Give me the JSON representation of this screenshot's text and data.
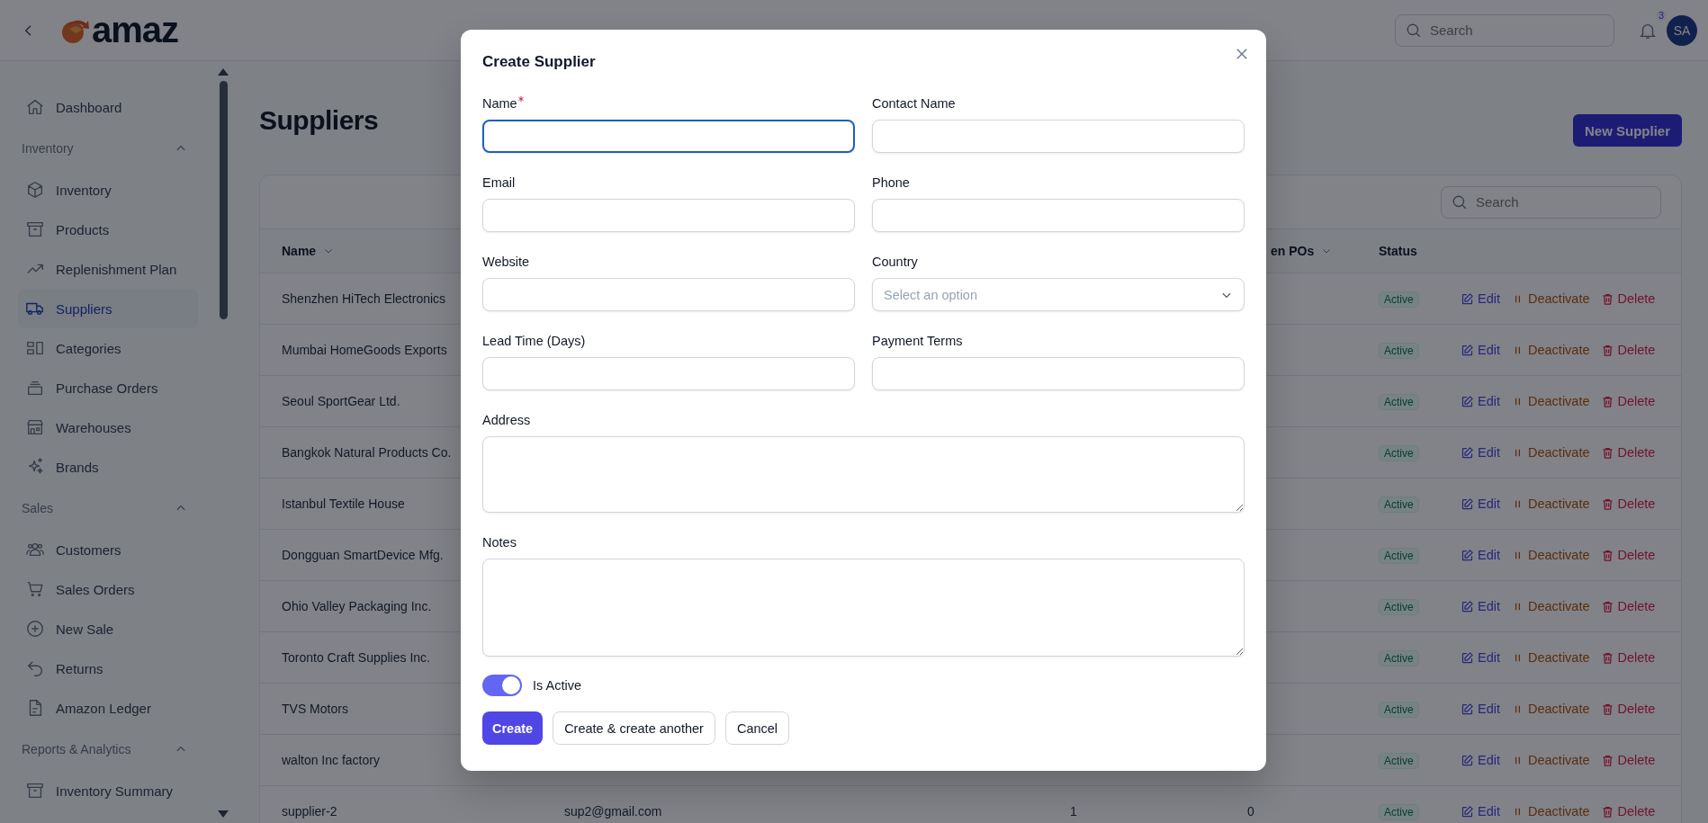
{
  "topbar": {
    "logo_text": "amaz",
    "search": {
      "placeholder": "Search"
    },
    "notifications": {
      "badge": "3"
    },
    "avatar": "SA"
  },
  "sidebar": {
    "items": [
      {
        "kind": "link",
        "label": "Dashboard",
        "selected": false
      },
      {
        "kind": "section",
        "label": "Inventory",
        "expanded": true
      },
      {
        "kind": "link",
        "label": "Inventory",
        "selected": false
      },
      {
        "kind": "link",
        "label": "Products",
        "selected": false
      },
      {
        "kind": "link",
        "label": "Replenishment Plan",
        "selected": false
      },
      {
        "kind": "link",
        "label": "Suppliers",
        "selected": true
      },
      {
        "kind": "link",
        "label": "Categories",
        "selected": false
      },
      {
        "kind": "link",
        "label": "Purchase Orders",
        "selected": false
      },
      {
        "kind": "link",
        "label": "Warehouses",
        "selected": false
      },
      {
        "kind": "link",
        "label": "Brands",
        "selected": false
      },
      {
        "kind": "section",
        "label": "Sales",
        "expanded": true
      },
      {
        "kind": "link",
        "label": "Customers",
        "selected": false
      },
      {
        "kind": "link",
        "label": "Sales Orders",
        "selected": false
      },
      {
        "kind": "link",
        "label": "New Sale",
        "selected": false
      },
      {
        "kind": "link",
        "label": "Returns",
        "selected": false
      },
      {
        "kind": "link",
        "label": "Amazon Ledger",
        "selected": false
      },
      {
        "kind": "section",
        "label": "Reports & Analytics",
        "expanded": true
      },
      {
        "kind": "link",
        "label": "Inventory Summary",
        "selected": false
      }
    ]
  },
  "page": {
    "title": "Suppliers",
    "new_button": "New Supplier",
    "table": {
      "search": {
        "placeholder": "Search"
      },
      "columns": [
        {
          "label": "Name",
          "sortable": true
        },
        {
          "label": "en POs",
          "sortable": true
        },
        {
          "label": "Status",
          "sortable": false
        }
      ],
      "rows": [
        {
          "name": "Shenzhen HiTech Electronics",
          "status": "Active",
          "actions": [
            {
              "kind": "edit",
              "label": "Edit"
            },
            {
              "kind": "deactivate",
              "label": "Deactivate"
            },
            {
              "kind": "delete",
              "label": "Delete"
            }
          ]
        },
        {
          "name": "Mumbai HomeGoods Exports",
          "status": "Active",
          "actions": [
            {
              "kind": "edit",
              "label": "Edit"
            },
            {
              "kind": "deactivate",
              "label": "Deactivate"
            },
            {
              "kind": "delete",
              "label": "Delete"
            }
          ]
        },
        {
          "name": "Seoul SportGear Ltd.",
          "status": "Active",
          "actions": [
            {
              "kind": "edit",
              "label": "Edit"
            },
            {
              "kind": "deactivate",
              "label": "Deactivate"
            },
            {
              "kind": "delete",
              "label": "Delete"
            }
          ]
        },
        {
          "name": "Bangkok Natural Products Co.",
          "status": "Active",
          "actions": [
            {
              "kind": "edit",
              "label": "Edit"
            },
            {
              "kind": "deactivate",
              "label": "Deactivate"
            },
            {
              "kind": "delete",
              "label": "Delete"
            }
          ]
        },
        {
          "name": "Istanbul Textile House",
          "status": "Active",
          "actions": [
            {
              "kind": "edit",
              "label": "Edit"
            },
            {
              "kind": "deactivate",
              "label": "Deactivate"
            },
            {
              "kind": "delete",
              "label": "Delete"
            }
          ]
        },
        {
          "name": "Dongguan SmartDevice Mfg.",
          "status": "Active",
          "actions": [
            {
              "kind": "edit",
              "label": "Edit"
            },
            {
              "kind": "deactivate",
              "label": "Deactivate"
            },
            {
              "kind": "delete",
              "label": "Delete"
            }
          ]
        },
        {
          "name": "Ohio Valley Packaging Inc.",
          "status": "Active",
          "actions": [
            {
              "kind": "edit",
              "label": "Edit"
            },
            {
              "kind": "deactivate",
              "label": "Deactivate"
            },
            {
              "kind": "delete",
              "label": "Delete"
            }
          ]
        },
        {
          "name": "Toronto Craft Supplies Inc.",
          "status": "Active",
          "actions": [
            {
              "kind": "edit",
              "label": "Edit"
            },
            {
              "kind": "deactivate",
              "label": "Deactivate"
            },
            {
              "kind": "delete",
              "label": "Delete"
            }
          ]
        },
        {
          "name": "TVS Motors",
          "status": "Active",
          "actions": [
            {
              "kind": "edit",
              "label": "Edit"
            },
            {
              "kind": "deactivate",
              "label": "Deactivate"
            },
            {
              "kind": "delete",
              "label": "Delete"
            }
          ]
        },
        {
          "name": "walton Inc factory",
          "status": "Active",
          "actions": [
            {
              "kind": "edit",
              "label": "Edit"
            },
            {
              "kind": "deactivate",
              "label": "Deactivate"
            },
            {
              "kind": "delete",
              "label": "Delete"
            }
          ]
        },
        {
          "name": "supplier-2",
          "email": "sup2@gmail.com",
          "column_3": "1",
          "column_4": "0",
          "status": "Active",
          "actions": [
            {
              "kind": "edit",
              "label": "Edit"
            },
            {
              "kind": "deactivate",
              "label": "Deactivate"
            },
            {
              "kind": "delete",
              "label": "Delete"
            }
          ]
        }
      ]
    }
  },
  "modal": {
    "title": "Create Supplier",
    "fields": [
      {
        "kind": "text",
        "label": "Name",
        "required": true,
        "focused": true
      },
      {
        "kind": "text",
        "label": "Contact Name",
        "required": false,
        "focused": false
      },
      {
        "kind": "text",
        "label": "Email",
        "required": false,
        "focused": false
      },
      {
        "kind": "text",
        "label": "Phone",
        "required": false,
        "focused": false
      },
      {
        "kind": "text",
        "label": "Website",
        "required": false,
        "focused": false
      },
      {
        "kind": "select",
        "label": "Country",
        "required": false,
        "focused": false,
        "placeholder": "Select an option"
      },
      {
        "kind": "text",
        "label": "Lead Time (Days)",
        "required": false,
        "focused": false
      },
      {
        "kind": "text",
        "label": "Payment Terms",
        "required": false,
        "focused": false
      },
      {
        "kind": "textarea",
        "label": "Address",
        "required": false,
        "focused": false
      },
      {
        "kind": "textarea",
        "label": "Notes",
        "required": false,
        "focused": false
      }
    ],
    "toggle": {
      "label": "Is Active",
      "on": true
    },
    "buttons": [
      {
        "kind": "primary",
        "label": "Create"
      },
      {
        "kind": "secondary",
        "label": "Create & create another"
      },
      {
        "kind": "secondary",
        "label": "Cancel"
      }
    ]
  }
}
